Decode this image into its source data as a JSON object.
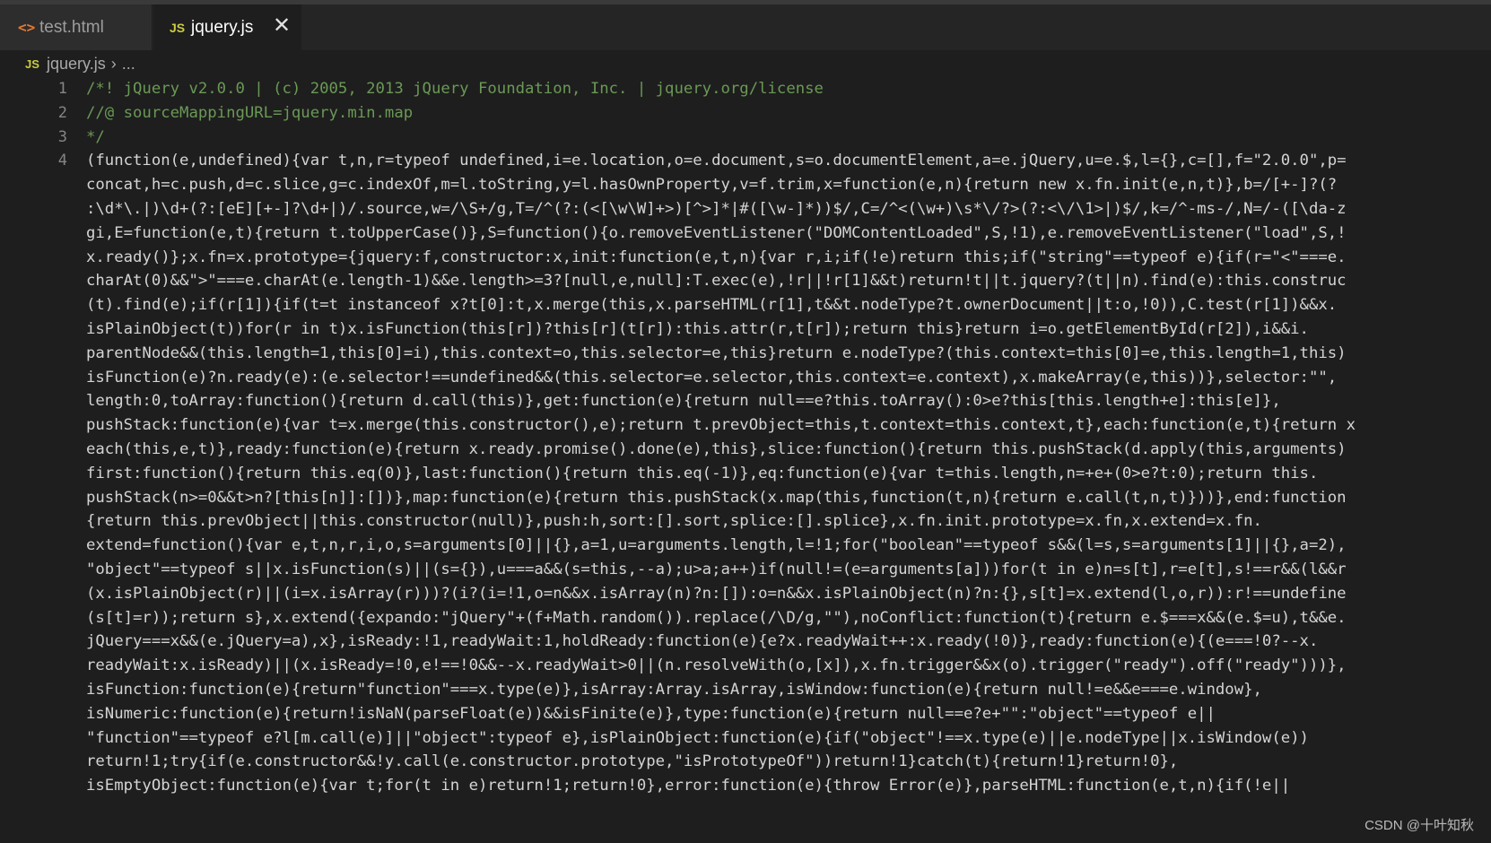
{
  "tabs": [
    {
      "label": "test.html",
      "icon": "html-icon"
    },
    {
      "label": "jquery.js",
      "icon": "js-icon",
      "active": true
    }
  ],
  "tab_close_glyph": "✕",
  "breadcrumb": {
    "js_badge": "JS",
    "file": "jquery.js",
    "separator": "›",
    "more": "..."
  },
  "html_icon_glyph": "<>",
  "line_numbers": [
    "1",
    "2",
    "3",
    "4"
  ],
  "code_lines": [
    "/*! jQuery v2.0.0 | (c) 2005, 2013 jQuery Foundation, Inc. | jquery.org/license",
    "//@ sourceMappingURL=jquery.min.map",
    "*/",
    "(function(e,undefined){var t,n,r=typeof undefined,i=e.location,o=e.document,s=o.documentElement,a=e.jQuery,u=e.$,l={},c=[],f=\"2.0.0\",p=",
    "concat,h=c.push,d=c.slice,g=c.indexOf,m=l.toString,y=l.hasOwnProperty,v=f.trim,x=function(e,n){return new x.fn.init(e,n,t)},b=/[+-]?(?",
    ":\\d*\\.|)\\d+(?:[eE][+-]?\\d+|)/.source,w=/\\S+/g,T=/^(?:(<[\\w\\W]+>)[^>]*|#([\\w-]*))$/,C=/^<(\\w+)\\s*\\/?>(?:<\\/\\1>|)$/,k=/^-ms-/,N=/-([\\da-z",
    "gi,E=function(e,t){return t.toUpperCase()},S=function(){o.removeEventListener(\"DOMContentLoaded\",S,!1),e.removeEventListener(\"load\",S,!",
    "x.ready()};x.fn=x.prototype={jquery:f,constructor:x,init:function(e,t,n){var r,i;if(!e)return this;if(\"string\"==typeof e){if(r=\"<\"===e.",
    "charAt(0)&&\">\"===e.charAt(e.length-1)&&e.length>=3?[null,e,null]:T.exec(e),!r||!r[1]&&t)return!t||t.jquery?(t||n).find(e):this.construc",
    "(t).find(e);if(r[1]){if(t=t instanceof x?t[0]:t,x.merge(this,x.parseHTML(r[1],t&&t.nodeType?t.ownerDocument||t:o,!0)),C.test(r[1])&&x.",
    "isPlainObject(t))for(r in t)x.isFunction(this[r])?this[r](t[r]):this.attr(r,t[r]);return this}return i=o.getElementById(r[2]),i&&i.",
    "parentNode&&(this.length=1,this[0]=i),this.context=o,this.selector=e,this}return e.nodeType?(this.context=this[0]=e,this.length=1,this)",
    "isFunction(e)?n.ready(e):(e.selector!==undefined&&(this.selector=e.selector,this.context=e.context),x.makeArray(e,this))},selector:\"\",",
    "length:0,toArray:function(){return d.call(this)},get:function(e){return null==e?this.toArray():0>e?this[this.length+e]:this[e]},",
    "pushStack:function(e){var t=x.merge(this.constructor(),e);return t.prevObject=this,t.context=this.context,t},each:function(e,t){return x",
    "each(this,e,t)},ready:function(e){return x.ready.promise().done(e),this},slice:function(){return this.pushStack(d.apply(this,arguments)",
    "first:function(){return this.eq(0)},last:function(){return this.eq(-1)},eq:function(e){var t=this.length,n=+e+(0>e?t:0);return this.",
    "pushStack(n>=0&&t>n?[this[n]]:[])},map:function(e){return this.pushStack(x.map(this,function(t,n){return e.call(t,n,t)}))},end:function",
    "{return this.prevObject||this.constructor(null)},push:h,sort:[].sort,splice:[].splice},x.fn.init.prototype=x.fn,x.extend=x.fn.",
    "extend=function(){var e,t,n,r,i,o,s=arguments[0]||{},a=1,u=arguments.length,l=!1;for(\"boolean\"==typeof s&&(l=s,s=arguments[1]||{},a=2),",
    "\"object\"==typeof s||x.isFunction(s)||(s={}),u===a&&(s=this,--a);u>a;a++)if(null!=(e=arguments[a]))for(t in e)n=s[t],r=e[t],s!==r&&(l&&r",
    "(x.isPlainObject(r)||(i=x.isArray(r)))?(i?(i=!1,o=n&&x.isArray(n)?n:[]):o=n&&x.isPlainObject(n)?n:{},s[t]=x.extend(l,o,r)):r!==undefine",
    "(s[t]=r));return s},x.extend({expando:\"jQuery\"+(f+Math.random()).replace(/\\D/g,\"\"),noConflict:function(t){return e.$===x&&(e.$=u),t&&e.",
    "jQuery===x&&(e.jQuery=a),x},isReady:!1,readyWait:1,holdReady:function(e){e?x.readyWait++:x.ready(!0)},ready:function(e){(e===!0?--x.",
    "readyWait:x.isReady)||(x.isReady=!0,e!==!0&&--x.readyWait>0||(n.resolveWith(o,[x]),x.fn.trigger&&x(o).trigger(\"ready\").off(\"ready\")))},",
    "isFunction:function(e){return\"function\"===x.type(e)},isArray:Array.isArray,isWindow:function(e){return null!=e&&e===e.window},",
    "isNumeric:function(e){return!isNaN(parseFloat(e))&&isFinite(e)},type:function(e){return null==e?e+\"\":\"object\"==typeof e||",
    "\"function\"==typeof e?l[m.call(e)]||\"object\":typeof e},isPlainObject:function(e){if(\"object\"!==x.type(e)||e.nodeType||x.isWindow(e))",
    "return!1;try{if(e.constructor&&!y.call(e.constructor.prototype,\"isPrototypeOf\"))return!1}catch(t){return!1}return!0},",
    "isEmptyObject:function(e){var t;for(t in e)return!1;return!0},error:function(e){throw Error(e)},parseHTML:function(e,t,n){if(!e||"
  ],
  "watermark": "CSDN @十叶知秋",
  "colors": {
    "background": "#1e1e1e",
    "comment": "#6a9955",
    "text": "#d4d4d4",
    "line_number": "#858585"
  }
}
